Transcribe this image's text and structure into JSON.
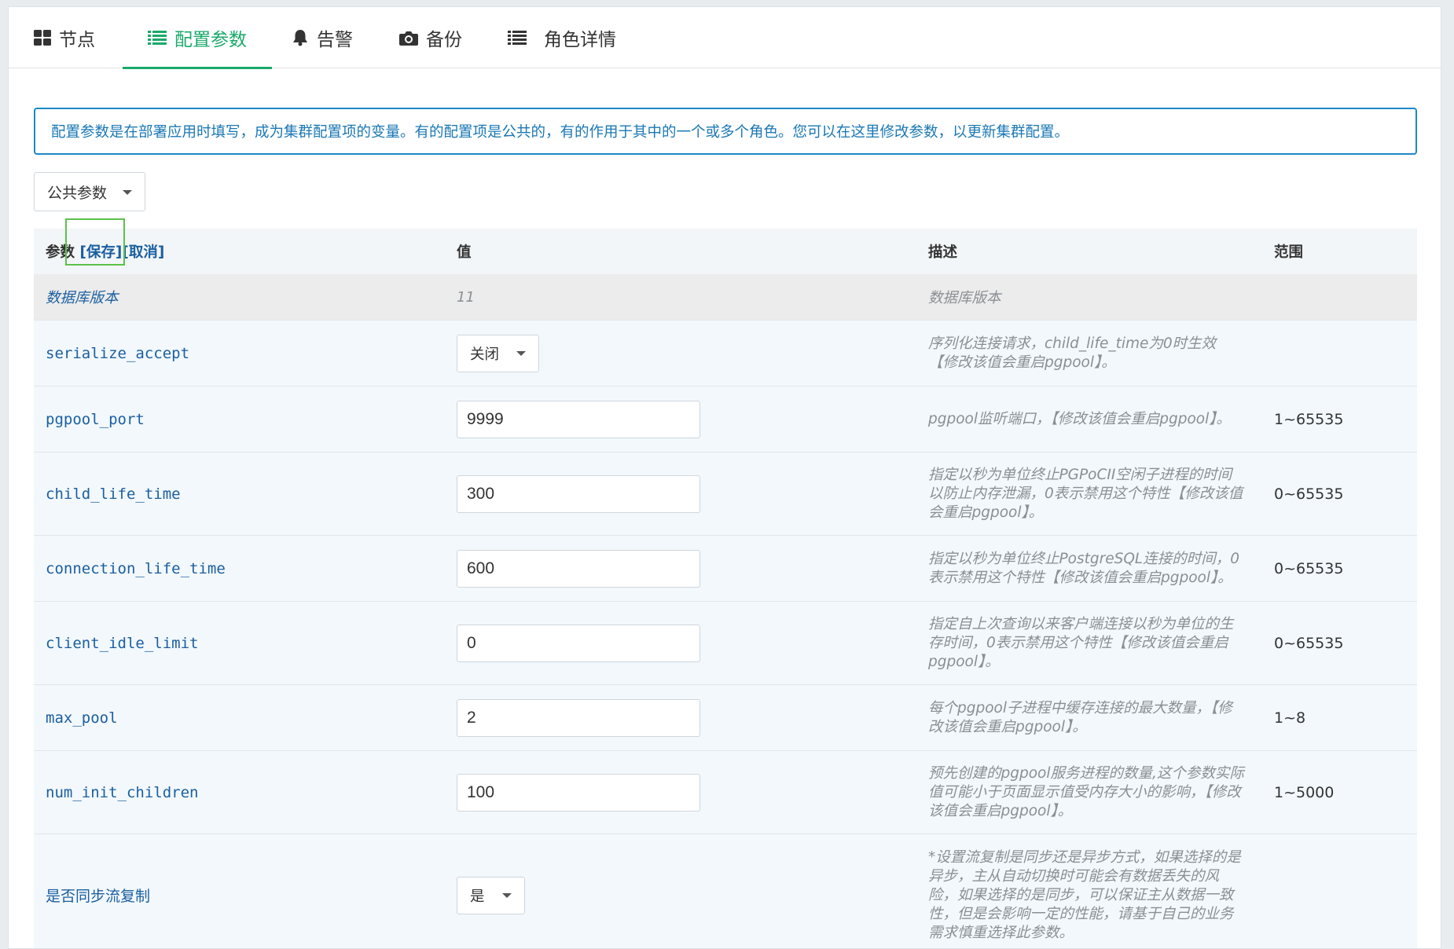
{
  "tabs": [
    {
      "label": "节点",
      "icon": "grid-icon",
      "active": false
    },
    {
      "label": "配置参数",
      "icon": "list-icon",
      "active": true
    },
    {
      "label": "告警",
      "icon": "bell-icon",
      "active": false
    },
    {
      "label": "备份",
      "icon": "camera-icon",
      "active": false
    },
    {
      "label": "角色详情",
      "icon": "list-icon",
      "active": false
    }
  ],
  "notice": "配置参数是在部署应用时填写，成为集群配置项的变量。有的配置项是公共的，有的作用于其中的一个或多个角色。您可以在这里修改参数，以更新集群配置。",
  "scope_select": {
    "value": "公共参数"
  },
  "table": {
    "headers": {
      "param": "参数",
      "save": "[保存]",
      "cancel": "[取消]",
      "value": "值",
      "desc": "描述",
      "range": "范围"
    },
    "version_row": {
      "name": "数据库版本",
      "value": "11",
      "desc": "数据库版本"
    },
    "rows": [
      {
        "name": "serialize_accept",
        "type": "select",
        "value": "关闭",
        "desc": "序列化连接请求，child_life_time为0时生效【修改该值会重启pgpool】。",
        "range": ""
      },
      {
        "name": "pgpool_port",
        "type": "input",
        "value": "9999",
        "desc": "pgpool监听端口，【修改该值会重启pgpool】。",
        "range": "1~65535"
      },
      {
        "name": "child_life_time",
        "type": "input",
        "value": "300",
        "desc": "指定以秒为单位终止PGPoCII空闲子进程的时间以防止内存泄漏，0表示禁用这个特性【修改该值会重启pgpool】。",
        "range": "0~65535"
      },
      {
        "name": "connection_life_time",
        "type": "input",
        "value": "600",
        "desc": "指定以秒为单位终止PostgreSQL连接的时间，0表示禁用这个特性【修改该值会重启pgpool】。",
        "range": "0~65535"
      },
      {
        "name": "client_idle_limit",
        "type": "input",
        "value": "0",
        "desc": "指定自上次查询以来客户端连接以秒为单位的生存时间，0表示禁用这个特性【修改该值会重启pgpool】。",
        "range": "0~65535"
      },
      {
        "name": "max_pool",
        "type": "input",
        "value": "2",
        "desc": "每个pgpool子进程中缓存连接的最大数量，【修改该值会重启pgpool】。",
        "range": "1~8"
      },
      {
        "name": "num_init_children",
        "type": "input",
        "value": "100",
        "desc": "预先创建的pgpool服务进程的数量,这个参数实际值可能小于页面显示值受内存大小的影响，【修改该值会重启pgpool】。",
        "range": "1~5000"
      },
      {
        "name": "是否同步流复制",
        "type": "select",
        "value": "是",
        "desc": "*设置流复制是同步还是异步方式，如果选择的是异步，主从自动切换时可能会有数据丢失的风险，如果选择的是同步，可以保证主从数据一致性，但是会影响一定的性能，请基于自己的业务需求慎重选择此参数。",
        "range": ""
      }
    ]
  },
  "colors": {
    "accent": "#1aa96a",
    "link": "#1b5fa0",
    "notice_border": "#1e88c7",
    "highlight_box": "#5ac24a"
  }
}
